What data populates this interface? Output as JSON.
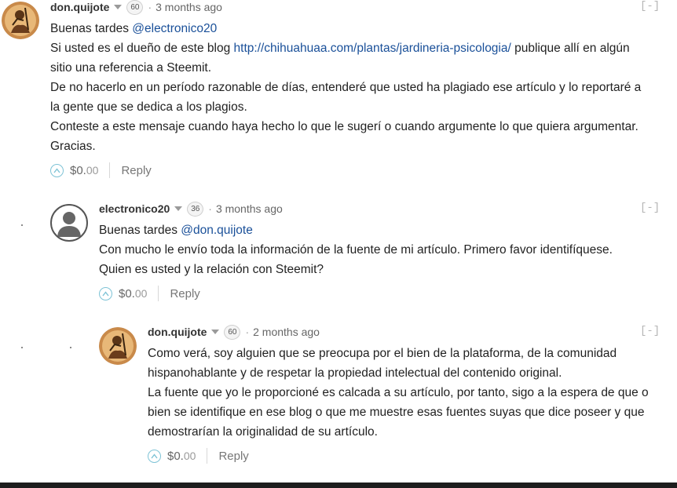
{
  "comments": [
    {
      "author": "don.quijote",
      "reputation": "60",
      "time": "3 months ago",
      "collapse": "[-]",
      "greeting": "Buenas tardes ",
      "mention": "@electronico20",
      "line2_pre": "Si usted es el dueño de este blog ",
      "link": "http://chihuahuaa.com/plantas/jardineria-psicologia/",
      "line2_post": " publique allí en algún",
      "line3": "sitio una referencia a Steemit.",
      "line4": "De no hacerlo en un período razonable de días, entenderé que usted ha plagiado ese artículo y lo reportaré a",
      "line5": "la gente que se dedica a los plagios.",
      "line6": "Conteste a este mensaje cuando haya hecho lo que le sugerí o cuando argumente lo que quiera argumentar.",
      "line7": "Gracias.",
      "payout_main": "$0.",
      "payout_cents": "00",
      "reply_label": "Reply",
      "avatar_icon": "don-quijote-avatar"
    },
    {
      "author": "electronico20",
      "reputation": "36",
      "time": "3 months ago",
      "collapse": "[-]",
      "greeting": "Buenas tardes ",
      "mention": "@don.quijote",
      "line2": "Con mucho le envío toda la información de la fuente de mi artículo. Primero favor identifíquese.",
      "line3": "Quien es usted y la relación con Steemit?",
      "payout_main": "$0.",
      "payout_cents": "00",
      "reply_label": "Reply",
      "avatar_icon": "default-user-avatar"
    },
    {
      "author": "don.quijote",
      "reputation": "60",
      "time": "2 months ago",
      "collapse": "[-]",
      "line1": "Como verá, soy alguien que se preocupa por el bien de la plataforma, de la comunidad",
      "line2": "hispanohablante y de respetar la propiedad intelectual del contenido original.",
      "line3": "La fuente que yo le proporcioné es calcada a su artículo, por tanto, sigo a la espera de que o",
      "line4": "bien se identifique en ese blog o que me muestre esas fuentes suyas que dice poseer y que",
      "line5": "demostrarían la originalidad de su artículo.",
      "payout_main": "$0.",
      "payout_cents": "00",
      "reply_label": "Reply",
      "avatar_icon": "don-quijote-avatar"
    }
  ],
  "colors": {
    "link": "#1a5099",
    "vote_ring": "#7ec3d6",
    "text": "#222222",
    "meta": "#666666"
  }
}
